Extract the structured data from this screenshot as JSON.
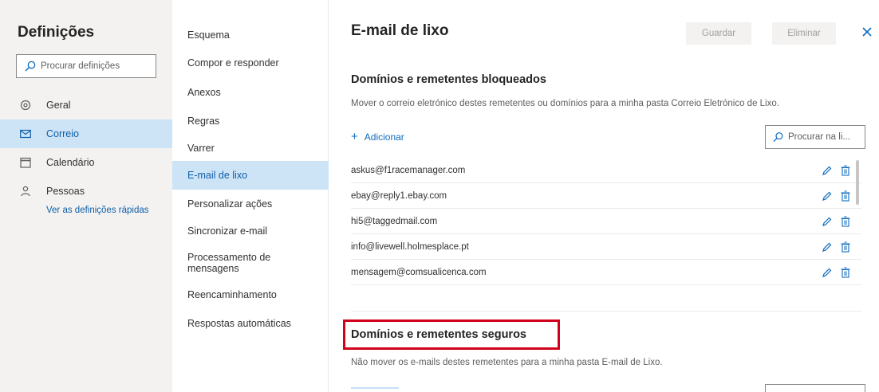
{
  "sidebar": {
    "title": "Definições",
    "search_placeholder": "Procurar definições",
    "items": [
      {
        "label": "Geral",
        "icon": "gear-icon"
      },
      {
        "label": "Correio",
        "icon": "mail-icon"
      },
      {
        "label": "Calendário",
        "icon": "calendar-icon"
      },
      {
        "label": "Pessoas",
        "icon": "people-icon"
      }
    ],
    "active_item": "Correio",
    "quick_settings_link": "Ver as definições rápidas"
  },
  "mail_nav": {
    "items": [
      "Esquema",
      "Compor e responder",
      "Anexos",
      "Regras",
      "Varrer",
      "E-mail de lixo",
      "Personalizar ações",
      "Sincronizar e-mail",
      "Processamento de mensagens",
      "Reencaminhamento",
      "Respostas automáticas"
    ],
    "active_item": "E-mail de lixo"
  },
  "content": {
    "title": "E-mail de lixo",
    "save_label": "Guardar",
    "delete_label": "Eliminar",
    "blocked": {
      "title": "Domínios e remetentes bloqueados",
      "description": "Mover o correio eletrónico destes remetentes ou domínios para a minha pasta Correio Eletrónico de Lixo.",
      "add_label": "Adicionar",
      "search_placeholder": "Procurar na li...",
      "senders": [
        "askus@f1racemanager.com",
        "ebay@reply1.ebay.com",
        "hi5@taggedmail.com",
        "info@livewell.holmesplace.pt",
        "mensagem@comsualicenca.com"
      ]
    },
    "safe": {
      "title": "Domínios e remetentes seguros",
      "description": "Não mover os e-mails destes remetentes para a minha pasta E-mail de Lixo."
    }
  },
  "colors": {
    "accent": "#0f6cbd",
    "active_bg": "#cde3f6",
    "highlight_box": "#d0021b",
    "sidebar_bg": "#f3f2f1"
  }
}
